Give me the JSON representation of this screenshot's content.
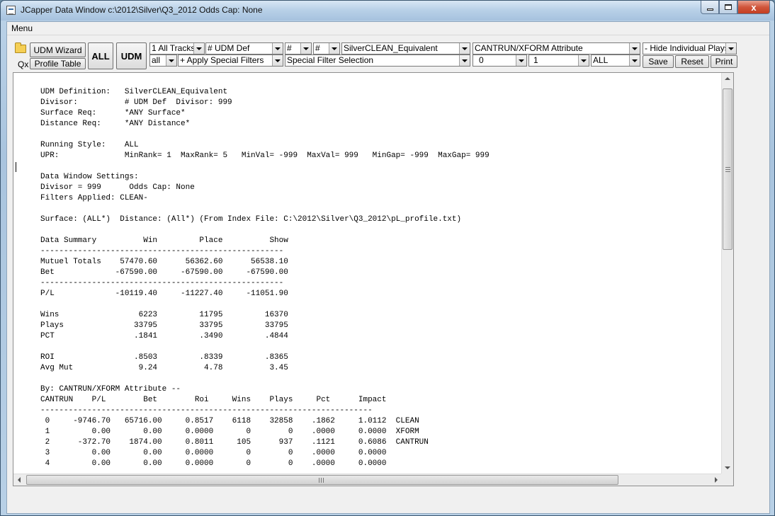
{
  "window": {
    "title": "JCapper Data Window c:\\2012\\Silver\\Q3_2012 Odds Cap: None",
    "close_glyph": "x"
  },
  "menu": {
    "label": "Menu"
  },
  "toolbar": {
    "udm_wizard": "UDM Wizard",
    "profile_table": "Profile Table",
    "qx": "Qx",
    "all_button": "ALL",
    "udm_button": "UDM",
    "save": "Save",
    "reset": "Reset",
    "print": "Print",
    "combos": {
      "tracks": "1 All Tracks",
      "all_filter": "all",
      "udm_def": "# UDM Def",
      "special_filters": "+ Apply Special Filters",
      "hash1": "#",
      "hash2": "#",
      "special_filter_selection": "Special Filter Selection",
      "udm_name": "SilverCLEAN_Equivalent",
      "attribute": "CANTRUN/XFORM Attribute",
      "min_val": "0",
      "max_val": "1",
      "hide_plays": "- Hide Individual Plays",
      "all_select": "ALL"
    }
  },
  "report": {
    "text": "UDM Definition:   SilverCLEAN_Equivalent\nDivisor:          # UDM Def  Divisor: 999\nSurface Req:      *ANY Surface*\nDistance Req:     *ANY Distance*\n\nRunning Style:    ALL\nUPR:              MinRank= 1  MaxRank= 5   MinVal= -999  MaxVal= 999   MinGap= -999  MaxGap= 999\n\nData Window Settings:\nDivisor = 999      Odds Cap: None\nFilters Applied: CLEAN-\n\nSurface: (ALL*)  Distance: (All*) (From Index File: C:\\2012\\Silver\\Q3_2012\\pL_profile.txt)\n\nData Summary          Win         Place          Show\n----------------------------------------------------\nMutuel Totals    57470.60      56362.60      56538.10\nBet             -67590.00     -67590.00     -67590.00\n----------------------------------------------------\nP/L             -10119.40     -11227.40     -11051.90\n\nWins                 6223         11795         16370\nPlays               33795         33795         33795\nPCT                 .1841         .3490         .4844\n\nROI                 .8503         .8339         .8365\nAvg Mut              9.24          4.78          3.45\n\nBy: CANTRUN/XFORM Attribute --\nCANTRUN    P/L        Bet        Roi     Wins    Plays     Pct      Impact\n-----------------------------------------------------------------------\n 0     -9746.70   65716.00     0.8517    6118    32858    .1862     1.0112  CLEAN\n 1         0.00       0.00     0.0000       0        0    .0000     0.0000  XFORM\n 2      -372.70    1874.00     0.8011     105      937    .1121     0.6086  CANTRUN\n 3         0.00       0.00     0.0000       0        0    .0000     0.0000\n 4         0.00       0.00     0.0000       0        0    .0000     0.0000"
  }
}
